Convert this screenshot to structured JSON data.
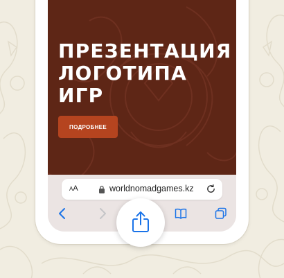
{
  "hero": {
    "title_line1": "ПРЕЗЕНТАЦИЯ",
    "title_line2": "ЛОГОТИПА ИГР",
    "more_button": "ПОДРОБНЕЕ"
  },
  "browser": {
    "text_size_label": "AA",
    "domain": "worldnomadgames.kz"
  },
  "icons": {
    "back": "chevron-left-icon",
    "forward": "chevron-right-icon",
    "share": "share-icon",
    "bookmarks": "book-icon",
    "tabs": "tabs-icon",
    "lock": "lock-icon",
    "reload": "reload-icon"
  },
  "colors": {
    "hero_bg": "#5e2616",
    "button": "#b5441f",
    "accent": "#1a73e8",
    "page_bg": "#f1ede1"
  }
}
